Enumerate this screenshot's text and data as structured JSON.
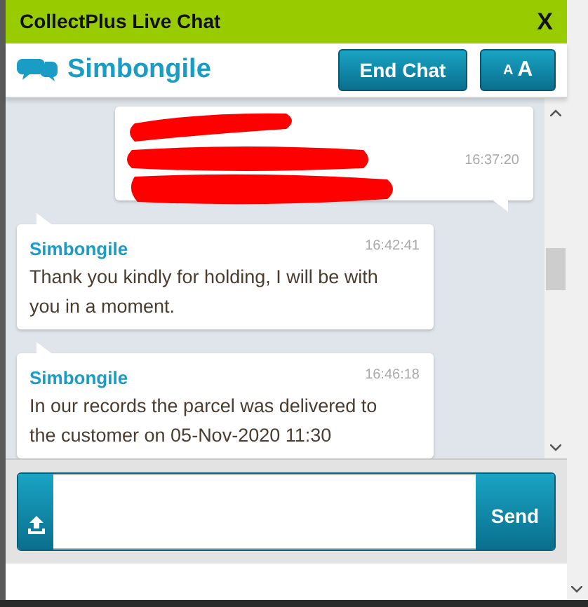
{
  "window": {
    "title": "CollectPlus Live Chat",
    "close": "X"
  },
  "header": {
    "agent": "Simbongile",
    "buttons": [
      "End Chat"
    ],
    "font_size": {
      "small": "A",
      "large": "A"
    }
  },
  "messages": [
    {
      "kind": "visitor",
      "redacted": true,
      "time": "16:37:20"
    },
    {
      "kind": "agent",
      "sender": "Simbongile",
      "time": "16:42:41",
      "text": "Thank you kindly for holding, I will be with you in a moment."
    },
    {
      "kind": "agent",
      "sender": "Simbongile",
      "time": "16:46:18",
      "text": "In our records the parcel was delivered to the customer on 05-Nov-2020 11:30"
    }
  ],
  "composer": {
    "send": "Send"
  }
}
